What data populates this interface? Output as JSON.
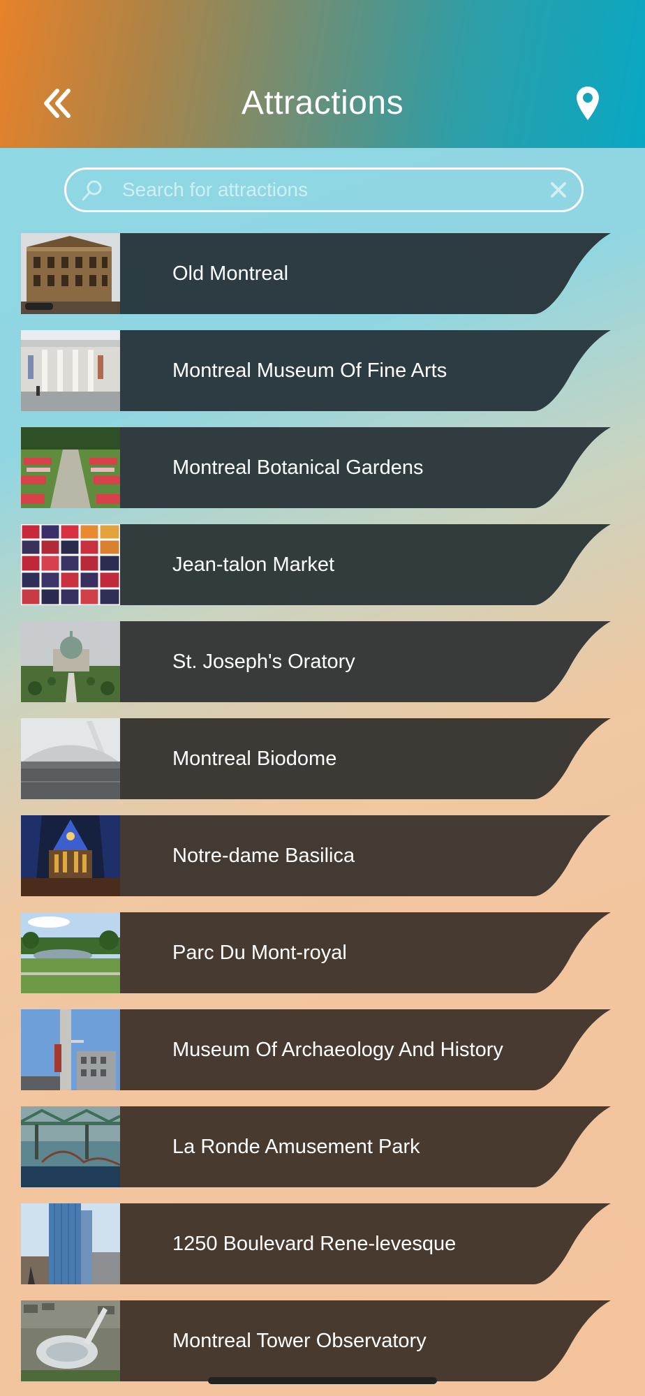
{
  "header": {
    "title": "Attractions",
    "back_icon": "double-chevron-left-icon",
    "location_icon": "map-pin-icon"
  },
  "search": {
    "placeholder": "Search for attractions",
    "value": "",
    "search_icon": "search-icon",
    "clear_icon": "close-icon"
  },
  "colors": {
    "header_gradient": [
      "#e7822a",
      "#08a8c4"
    ],
    "background_gradient": [
      "#8fd8e4",
      "#f3c49c"
    ],
    "card_gradient": [
      "#2a3c44",
      "#493a2f"
    ],
    "text": "#ffffff"
  },
  "attractions": [
    {
      "label": "Old Montreal",
      "thumbnail": "stone-building-thumbnail"
    },
    {
      "label": "Montreal Museum Of Fine Arts",
      "thumbnail": "museum-columns-thumbnail"
    },
    {
      "label": "Montreal Botanical Gardens",
      "thumbnail": "flower-garden-thumbnail"
    },
    {
      "label": "Jean-talon Market",
      "thumbnail": "fruit-market-thumbnail"
    },
    {
      "label": "St. Joseph's Oratory",
      "thumbnail": "domed-oratory-thumbnail"
    },
    {
      "label": "Montreal Biodome",
      "thumbnail": "biodome-thumbnail"
    },
    {
      "label": "Notre-dame Basilica",
      "thumbnail": "basilica-interior-thumbnail"
    },
    {
      "label": "Parc Du Mont-royal",
      "thumbnail": "park-lake-thumbnail"
    },
    {
      "label": "Museum Of Archaeology And History",
      "thumbnail": "archaeology-museum-thumbnail"
    },
    {
      "label": "La Ronde Amusement Park",
      "thumbnail": "bridge-thumbnail"
    },
    {
      "label": "1250 Boulevard Rene-levesque",
      "thumbnail": "skyscraper-thumbnail"
    },
    {
      "label": "Montreal Tower Observatory",
      "thumbnail": "olympic-stadium-thumbnail"
    }
  ]
}
